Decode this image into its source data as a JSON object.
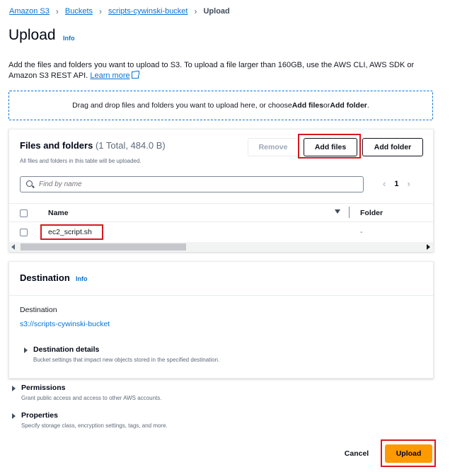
{
  "breadcrumb": {
    "items": [
      "Amazon S3",
      "Buckets",
      "scripts-cywinski-bucket"
    ],
    "current": "Upload"
  },
  "header": {
    "title": "Upload",
    "info": "Info",
    "description": "Add the files and folders you want to upload to S3. To upload a file larger than 160GB, use the AWS CLI, AWS SDK or Amazon S3 REST API.",
    "learn_more": "Learn more"
  },
  "dropzone": {
    "text_prefix": "Drag and drop files and folders you want to upload here, or choose ",
    "add_files": "Add files",
    "or": " or ",
    "add_folder": "Add folder",
    "suffix": "."
  },
  "files_panel": {
    "title": "Files and folders",
    "count": "(1 Total, 484.0 B)",
    "subtitle": "All files and folders in this table will be uploaded.",
    "remove_label": "Remove",
    "add_files_label": "Add files",
    "add_folder_label": "Add folder",
    "search_placeholder": "Find by name",
    "page": "1",
    "columns": [
      "Name",
      "Folder"
    ],
    "rows": [
      {
        "name": "ec2_script.sh",
        "folder": "-"
      }
    ]
  },
  "destination": {
    "title": "Destination",
    "info": "Info",
    "label": "Destination",
    "value": "s3://scripts-cywinski-bucket",
    "details_title": "Destination details",
    "details_desc": "Bucket settings that impact new objects stored in the specified destination."
  },
  "permissions": {
    "title": "Permissions",
    "desc": "Grant public access and access to other AWS accounts."
  },
  "properties": {
    "title": "Properties",
    "desc": "Specify storage class, encryption settings, tags, and more."
  },
  "footer": {
    "cancel_label": "Cancel",
    "upload_label": "Upload"
  },
  "colors": {
    "primary_link": "#0972d3",
    "upload_button": "#ff9900",
    "highlight_box": "#d71920"
  }
}
